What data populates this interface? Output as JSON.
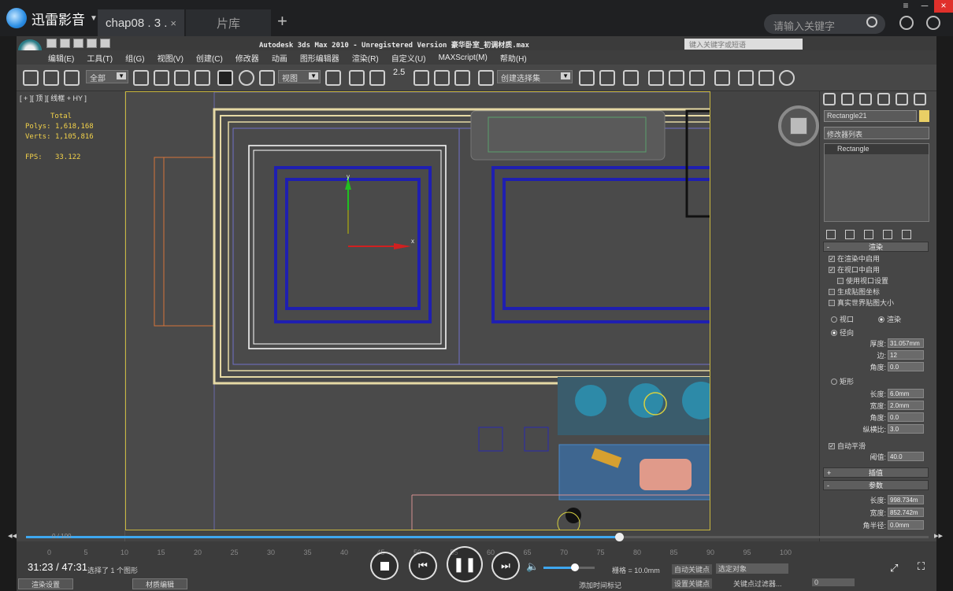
{
  "player": {
    "brand": "迅雷影音",
    "tabs": [
      {
        "label": "chap08 . 3 . ",
        "close": "×"
      },
      {
        "label": "片库"
      }
    ],
    "new_tab": "+",
    "search_placeholder": "请输入关键字",
    "current_time": "31:23",
    "total_time": "47:31",
    "time_sep": " / ",
    "progress_fraction": 0.657,
    "volume_fraction": 0.62,
    "window_controls": [
      "≡",
      "─",
      "×"
    ]
  },
  "max": {
    "title": "Autodesk 3ds Max  2010   - Unregistered Version  豪华卧室_初调材质.max",
    "keyword_placeholder": "键入关键字或短语",
    "menu": [
      "编辑(E)",
      "工具(T)",
      "组(G)",
      "视图(V)",
      "创建(C)",
      "修改器",
      "动画",
      "图形编辑器",
      "渲染(R)",
      "自定义(U)",
      "MAXScript(M)",
      "帮助(H)"
    ],
    "toolbar": {
      "filter": "全部",
      "ref_coord": "视图",
      "snap_value": "2.5",
      "selection_set": "创建选择集"
    },
    "viewport": {
      "label": "[ + ][ 顶 ][ 线框 + HY ]",
      "stats_title": "Total",
      "polys_label": "Polys:",
      "polys": "1,618,168",
      "verts_label": "Verts:",
      "verts": "1,105,816",
      "fps_label": "FPS:",
      "fps": "33.122",
      "gizmo_x": "x",
      "gizmo_y": "y"
    },
    "command_panel": {
      "object_name": "Rectangle21",
      "modifier_list": "修改器列表",
      "stack_item": "Rectangle",
      "render_rollout": "渲染",
      "enable_in_renderer": "在渲染中启用",
      "enable_in_viewport": "在视口中启用",
      "use_viewport_settings": "使用视口设置",
      "gen_mapping": "生成贴图坐标",
      "real_world": "真实世界贴图大小",
      "viewport_radio": "视口",
      "render_radio": "渲染",
      "radial": "径向",
      "thickness_label": "厚度:",
      "thickness": "31.057mm",
      "sides_label": "边:",
      "sides": "12",
      "angle_label": "角度:",
      "angle": "0.0",
      "rectangular": "矩形",
      "length_label": "长度:",
      "length": "6.0mm",
      "width_label": "宽度:",
      "width": "2.0mm",
      "angle2_label": "角度:",
      "angle2": "0.0",
      "aspect_label": "纵横比:",
      "aspect": "3.0",
      "auto_smooth": "自动平滑",
      "threshold_label": "阈值:",
      "threshold": "40.0",
      "interp_rollout": "插值",
      "params_rollout": "参数",
      "param_length_label": "长度:",
      "param_length": "998.734m",
      "param_width_label": "宽度:",
      "param_width": "852.742m",
      "param_corner_label": "角半径:",
      "param_corner": "0.0mm"
    },
    "timeline": {
      "frame": "0 / 100",
      "ticks": [
        "0",
        "5",
        "10",
        "15",
        "20",
        "25",
        "30",
        "35",
        "40",
        "45",
        "50",
        "55",
        "60",
        "65",
        "70",
        "75",
        "80",
        "85",
        "90",
        "95",
        "100"
      ]
    },
    "status": {
      "selected": "选择了 1 个图形",
      "grid": "栅格 = 10.0mm",
      "auto_key": "自动关键点",
      "set_key": "设置关键点",
      "selected_obj": "选定对象",
      "key_filter": "关键点过滤器...",
      "add_time_tag": "添加时间标记",
      "frame_spinner": "0"
    },
    "taskbar": [
      {
        "label": "渲染设置"
      },
      {
        "label": "材质编辑"
      }
    ]
  }
}
